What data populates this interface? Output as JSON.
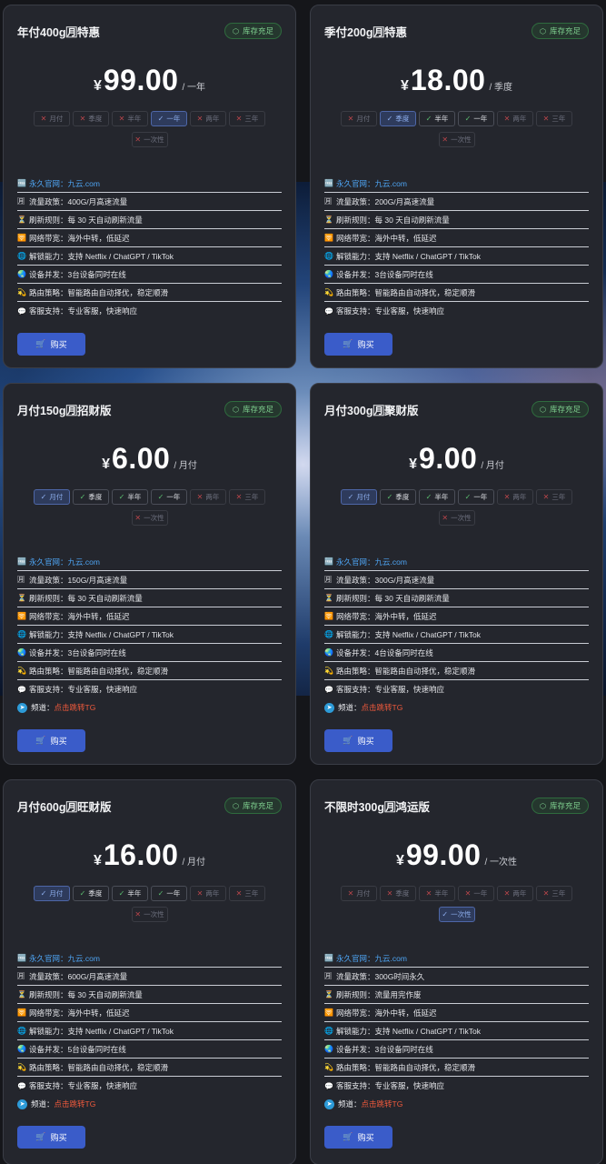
{
  "stock_label": "库存充足",
  "buy_label": "购买",
  "feature_labels": {
    "site": "永久官网：",
    "traffic": "流量政策：",
    "refresh": "刷新规则：",
    "bandwidth": "网络带宽：",
    "unlock": "解锁能力：",
    "devices": "设备并发：",
    "routing": "路由策略：",
    "support": "客服支持：",
    "channel": "频道："
  },
  "period_labels": [
    "月付",
    "季度",
    "半年",
    "一年",
    "两年",
    "三年",
    "一次性"
  ],
  "cards": [
    {
      "title": "年付400g🈷特惠",
      "currency": "¥",
      "price": "99.00",
      "unit": "/ 一年",
      "periods": [
        "off",
        "off",
        "off",
        "sel",
        "off",
        "off",
        "off"
      ],
      "site": "九云.com",
      "traffic": "400G/月高速流量",
      "refresh": "每 30 天自动刷新流量",
      "bandwidth": "海外中转，低延迟",
      "unlock": "支持 Netflix / ChatGPT / TikTok",
      "devices": "3台设备同时在线",
      "routing": "智能路由自动择优，稳定顺滑",
      "support": "专业客服，快速响应",
      "channel": null
    },
    {
      "title": "季付200g🈷特惠",
      "currency": "¥",
      "price": "18.00",
      "unit": "/ 季度",
      "periods": [
        "off",
        "sel",
        "on",
        "on",
        "off",
        "off",
        "off"
      ],
      "site": "九云.com",
      "traffic": "200G/月高速流量",
      "refresh": "每 30 天自动刷新流量",
      "bandwidth": "海外中转，低延迟",
      "unlock": "支持 Netflix / ChatGPT / TikTok",
      "devices": "3台设备同时在线",
      "routing": "智能路由自动择优，稳定顺滑",
      "support": "专业客服，快速响应",
      "channel": null
    },
    {
      "title": "月付150g🈷招财版",
      "currency": "¥",
      "price": "6.00",
      "unit": "/ 月付",
      "periods": [
        "sel",
        "on",
        "on",
        "on",
        "off",
        "off",
        "off"
      ],
      "site": "九云.com",
      "traffic": "150G/月高速流量",
      "refresh": "每 30 天自动刷新流量",
      "bandwidth": "海外中转，低延迟",
      "unlock": "支持 Netflix / ChatGPT / TikTok",
      "devices": "3台设备同时在线",
      "routing": "智能路由自动择优，稳定顺滑",
      "support": "专业客服，快速响应",
      "channel": "点击跳转TG"
    },
    {
      "title": "月付300g🈷聚财版",
      "currency": "¥",
      "price": "9.00",
      "unit": "/ 月付",
      "periods": [
        "sel",
        "on",
        "on",
        "on",
        "off",
        "off",
        "off"
      ],
      "site": "九云.com",
      "traffic": "300G/月高速流量",
      "refresh": "每 30 天自动刷新流量",
      "bandwidth": "海外中转，低延迟",
      "unlock": "支持 Netflix / ChatGPT / TikTok",
      "devices": "4台设备同时在线",
      "routing": "智能路由自动择优，稳定顺滑",
      "support": "专业客服，快速响应",
      "channel": "点击跳转TG"
    },
    {
      "title": "月付600g🈷旺财版",
      "currency": "¥",
      "price": "16.00",
      "unit": "/ 月付",
      "periods": [
        "sel",
        "on",
        "on",
        "on",
        "off",
        "off",
        "off"
      ],
      "site": "九云.com",
      "traffic": "600G/月高速流量",
      "refresh": "每 30 天自动刷新流量",
      "bandwidth": "海外中转，低延迟",
      "unlock": "支持 Netflix / ChatGPT / TikTok",
      "devices": "5台设备同时在线",
      "routing": "智能路由自动择优，稳定顺滑",
      "support": "专业客服，快速响应",
      "channel": "点击跳转TG"
    },
    {
      "title": "不限时300g🈷鸿运版",
      "currency": "¥",
      "price": "99.00",
      "unit": "/ 一次性",
      "periods": [
        "off",
        "off",
        "off",
        "off",
        "off",
        "off",
        "sel"
      ],
      "site": "九云.com",
      "traffic": "300G时间永久",
      "refresh": "流量用完作废",
      "bandwidth": "海外中转，低延迟",
      "unlock": "支持 Netflix / ChatGPT / TikTok",
      "devices": "3台设备同时在线",
      "routing": "智能路由自动择优，稳定顺滑",
      "support": "专业客服，快速响应",
      "channel": "点击跳转TG"
    }
  ]
}
